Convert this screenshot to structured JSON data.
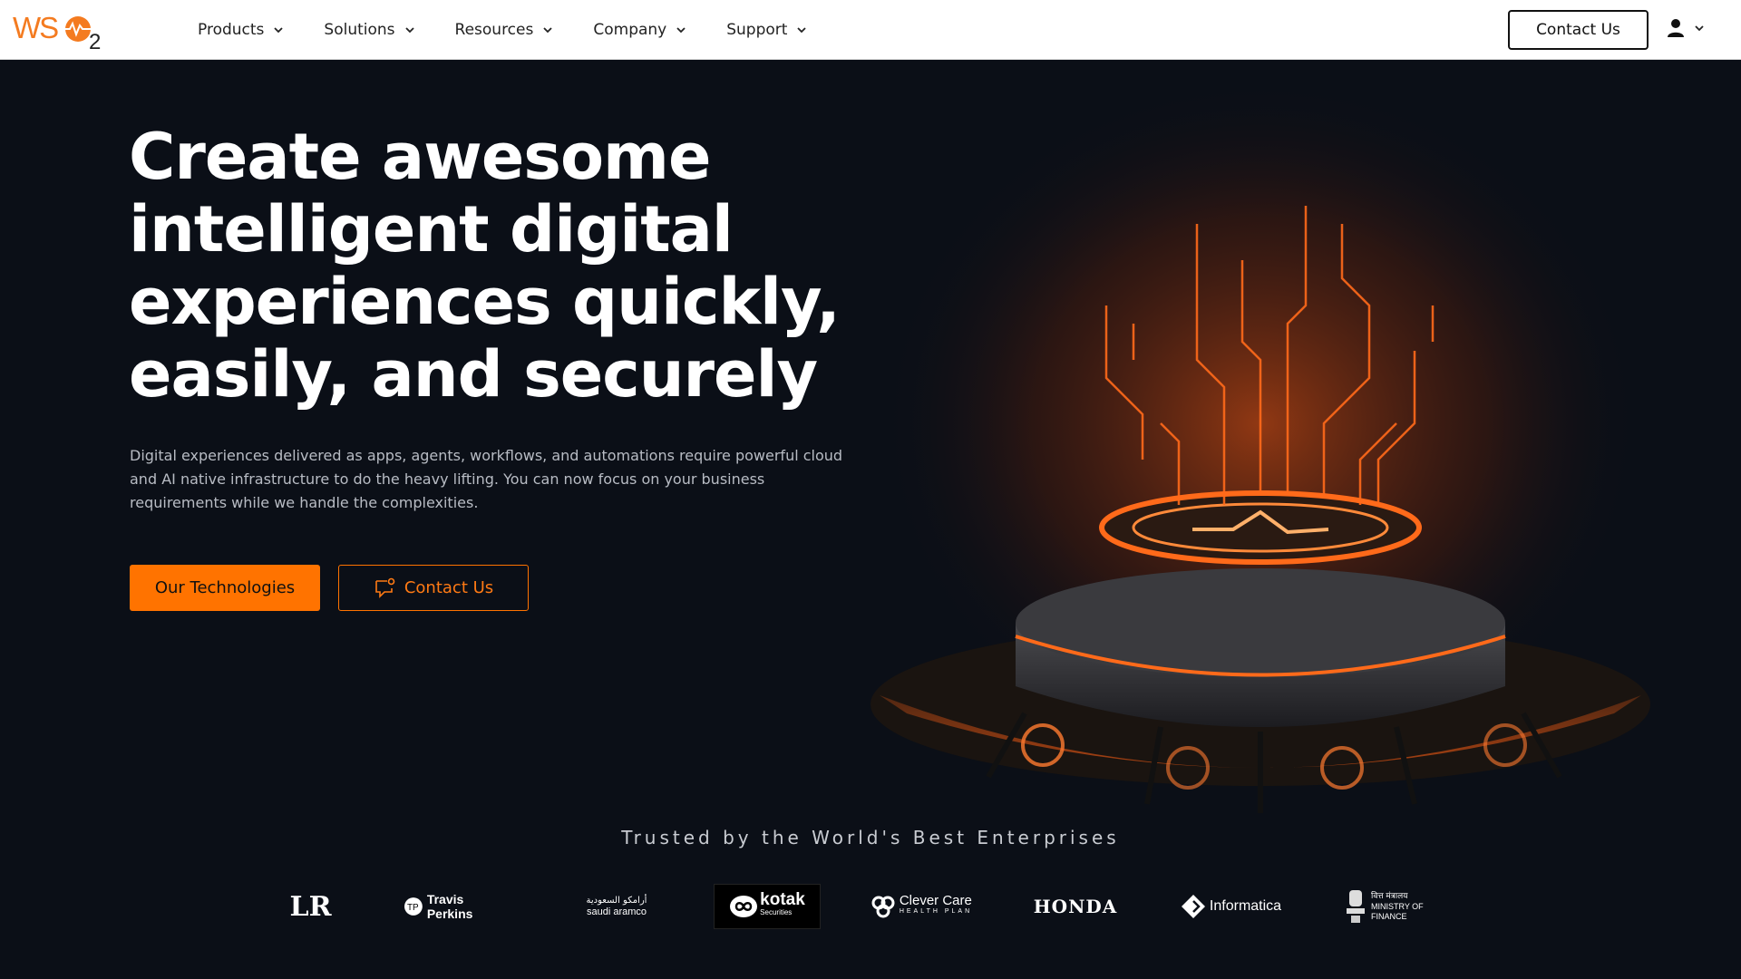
{
  "nav": {
    "logo_text": "WSO2",
    "menu": [
      {
        "label": "Products"
      },
      {
        "label": "Solutions"
      },
      {
        "label": "Resources"
      },
      {
        "label": "Company"
      },
      {
        "label": "Support"
      }
    ],
    "contact_label": "Contact Us",
    "user_icon": "user-icon"
  },
  "hero": {
    "title_lines": [
      "Create awesome",
      "intelligent digital",
      "experiences quickly,",
      "easily, and securely"
    ],
    "description": "Digital experiences delivered as apps, agents, workflows, and automations require powerful cloud and AI native infrastructure to do the heavy lifting. You can now focus on your business requirements while we handle the complexities.",
    "primary_button": "Our Technologies",
    "secondary_button": "Contact Us"
  },
  "trusted": {
    "heading": "Trusted by the World's Best Enterprises",
    "logos": [
      {
        "name": "LR",
        "text": "LR"
      },
      {
        "name": "travis-perkins",
        "text": "Travis Perkins"
      },
      {
        "name": "saudi-aramco",
        "text": "saudi aramco",
        "text_ar": "أرامكو السعودية"
      },
      {
        "name": "kotak",
        "text": "kotak",
        "subtext": "Securities"
      },
      {
        "name": "clever-care",
        "text": "Clever Care",
        "subtext": "HEALTH PLAN"
      },
      {
        "name": "honda",
        "text": "HONDA"
      },
      {
        "name": "informatica",
        "text": "Informatica"
      },
      {
        "name": "ministry-of-finance",
        "text": "MINISTRY OF FINANCE",
        "text_hi": "वित्त मंत्रालय"
      }
    ]
  },
  "colors": {
    "accent": "#ff7300",
    "background": "#0b0f17",
    "nav_bg": "#ffffff"
  }
}
